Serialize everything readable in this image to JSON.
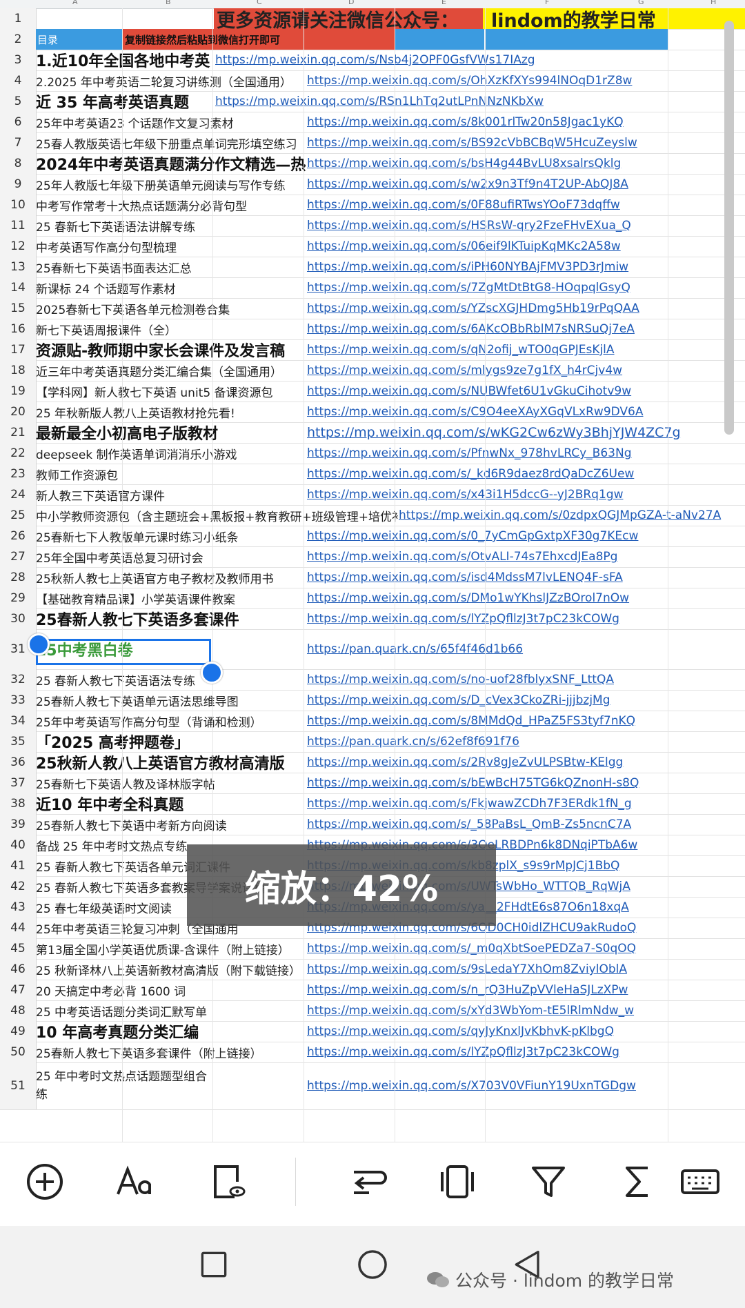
{
  "columns": [
    "A",
    "B",
    "C",
    "D",
    "E",
    "F",
    "G",
    "H"
  ],
  "banner": {
    "text1": "更多资源请关注微信公众号：",
    "text2": "lindom的教学日常"
  },
  "row2": {
    "catalog": "目录",
    "hint": "复制链接然后粘贴到微信打开即可"
  },
  "rows": [
    {
      "n": "3",
      "title": "1.近10年全国各地中考英",
      "link": "https://mp.weixin.qq.com/s/Nsb4j2OPF0GsfVWs17IAzg"
    },
    {
      "n": "4",
      "title": "2.2025 年中考英语二轮复习讲练测（全国通用）",
      "link": "https://mp.weixin.qq.com/s/OhXzKfXYs994lNOqD1rZ8w"
    },
    {
      "n": "5",
      "title": "近 35 年高考英语真题",
      "link": "https://mp.weixin.qq.com/s/RSn1LhTq2utLPnNNzNKbXw"
    },
    {
      "n": "6",
      "title": "25年中考英语23 个话题作文复习素材",
      "link": "https://mp.weixin.qq.com/s/8k001rlTw20n58Jgac1yKQ"
    },
    {
      "n": "7",
      "title": "25春人教版英语七年级下册重点单词完形填空练习",
      "link": "https://mp.weixin.qq.com/s/BS92cVbBCBqW5HcuZeyslw"
    },
    {
      "n": "8",
      "title": "2024年中考英语真题满分作文精选—热",
      "link": "https://mp.weixin.qq.com/s/bsH4g44BvLU8xsalrsQklg"
    },
    {
      "n": "9",
      "title": "25年人教版七年级下册英语单元阅读与写作专练",
      "link": "https://mp.weixin.qq.com/s/w2x9n3Tf9n4T2UP-AbQJ8A"
    },
    {
      "n": "10",
      "title": "中考写作常考十大热点话题满分必背句型",
      "link": "https://mp.weixin.qq.com/s/0F88ufiRTwsYOoF73dqffw"
    },
    {
      "n": "11",
      "title": "25 春新七下英语语法讲解专练",
      "link": "https://mp.weixin.qq.com/s/HSRsW-qry2FzeFHvEXua_Q"
    },
    {
      "n": "12",
      "title": "中考英语写作高分句型梳理",
      "link": "https://mp.weixin.qq.com/s/06eif9lKTuipKqMKc2A58w"
    },
    {
      "n": "13",
      "title": "25春新七下英语书面表达汇总",
      "link": "https://mp.weixin.qq.com/s/iPH60NYBAjFMV3PD3rJmiw"
    },
    {
      "n": "14",
      "title": "新课标 24 个话题写作素材",
      "link": "https://mp.weixin.qq.com/s/7ZgMtDtBtG8-HOqpqlGsyQ"
    },
    {
      "n": "15",
      "title": "2025春新七下英语各单元检测卷合集",
      "link": "https://mp.weixin.qq.com/s/YZscXGJHDmg5Hb19rPqQAA"
    },
    {
      "n": "16",
      "title": "新七下英语周报课件（全）",
      "link": "https://mp.weixin.qq.com/s/6AKcOBbRblM7sNRSuQj7eA"
    },
    {
      "n": "17",
      "title": "资源贴-教师期中家长会课件及发言稿",
      "link": "https://mp.weixin.qq.com/s/qN2ofij_wTO0qGPJEsKjlA"
    },
    {
      "n": "18",
      "title": "近三年中考英语真题分类汇编合集（全国通用）",
      "link": "https://mp.weixin.qq.com/s/mlygs9ze7g1fX_h4rCjv4w"
    },
    {
      "n": "19",
      "title": "【学科网】新人教七下英语 unit5 备课资源包",
      "link": "https://mp.weixin.qq.com/s/NUBWfet6U1vGkuCihotv9w"
    },
    {
      "n": "20",
      "title": "25 年秋新版人教八上英语教材抢先看!",
      "link": "https://mp.weixin.qq.com/s/C9O4eeXAyXGqVLxRw9DV6A"
    },
    {
      "n": "21",
      "title": "最新最全小初高电子版教材",
      "link": "https://mp.weixin.qq.com/s/wKG2Cw6zWy3BhjYJW4ZC7g"
    },
    {
      "n": "22",
      "title": "deepseek 制作英语单词消消乐小游戏",
      "link": "https://mp.weixin.qq.com/s/PfnwNx_978hvLRCy_B63Ng"
    },
    {
      "n": "23",
      "title": "教师工作资源包",
      "link": "https://mp.weixin.qq.com/s/_kd6R9daez8rdQaDcZ6Uew"
    },
    {
      "n": "24",
      "title": "新人教三下英语官方课件",
      "link": "https://mp.weixin.qq.com/s/x43i1H5dccG--yJ2BRq1gw"
    },
    {
      "n": "25",
      "title": "中小学教师资源包（含主题班会+黑板报+教育教研+班级管理+培优补差",
      "link": "https://mp.weixin.qq.com/s/0zdpxQGJMpGZA-t-aNv27A"
    },
    {
      "n": "26",
      "title": "25春新七下人教版单元课时练习小纸条",
      "link": "https://mp.weixin.qq.com/s/0_7yCmGpGxtpXF30g7KEcw"
    },
    {
      "n": "27",
      "title": "25年全国中考英语总复习研讨会",
      "link": "https://mp.weixin.qq.com/s/OtvALI-74s7EhxcdJEa8Pg"
    },
    {
      "n": "28",
      "title": "25秋新人教七上英语官方电子教材及教师用书",
      "link": "https://mp.weixin.qq.com/s/isd4MdssM7lvLENQ4F-sFA"
    },
    {
      "n": "29",
      "title": "【基础教育精品课】小学英语课件教案",
      "link": "https://mp.weixin.qq.com/s/DMo1wYKhslJZzBOrol7nOw"
    },
    {
      "n": "30",
      "title": "25春新人教七下英语多套课件",
      "link": "https://mp.weixin.qq.com/s/lYZpQfllzJ3t7pC23kCOWg"
    },
    {
      "n": "31",
      "title": "25中考黑白卷",
      "link": "https://pan.quark.cn/s/65f4f46d1b66"
    },
    {
      "n": "32",
      "title": "25 春新人教七下英语语法专练",
      "link": "https://mp.weixin.qq.com/s/no-uof28fblyxSNF_LttQA"
    },
    {
      "n": "33",
      "title": "25春新人教七下英语单元语法思维导图",
      "link": "https://mp.weixin.qq.com/s/D_cVex3CkoZRi-jjjbzjMg"
    },
    {
      "n": "34",
      "title": "25年中考英语写作高分句型（背诵和检测）",
      "link": "https://mp.weixin.qq.com/s/8MMdQd_HPaZ5FS3tyf7nKQ"
    },
    {
      "n": "35",
      "title": "「2025 高考押题卷」",
      "link": "https://pan.quark.cn/s/62ef8f691f76"
    },
    {
      "n": "36",
      "title": "25秋新人教八上英语官方教材高清版",
      "link": "https://mp.weixin.qq.com/s/2Rv8gJeZvULPSBtw-KElgg"
    },
    {
      "n": "37",
      "title": "25春新七下英语人教及译林版字帖",
      "link": "https://mp.weixin.qq.com/s/bEwBcH75TG6kQZnonH-s8Q"
    },
    {
      "n": "38",
      "title": "近10 年中考全科真题",
      "link": "https://mp.weixin.qq.com/s/FkjwawZCDh7F3ERdk1fN_g"
    },
    {
      "n": "39",
      "title": "25春新人教七下英语中考新方向阅读",
      "link": "https://mp.weixin.qq.com/s/_58PaBsL_QmB-Zs5ncnC7A"
    },
    {
      "n": "40",
      "title": "备战 25 年中考时文热点专练",
      "link": "https://mp.weixin.qq.com/s/3OeLRBDPn6k8DNqiPTbA6w"
    },
    {
      "n": "41",
      "title": "25 春新人教七下英语各单元词汇课件",
      "link": "https://mp.weixin.qq.com/s/kb8zplX_s9s9rMpJCj1BbQ"
    },
    {
      "n": "42",
      "title": "25 春新人教七下英语多套教案导学案说课稿",
      "link": "https://mp.weixin.qq.com/s/UWTsWbHo_WTTQB_RqWjA"
    },
    {
      "n": "43",
      "title": "25 春七年级英语时文阅读",
      "link": "https://mp.weixin.qq.com/s/ya__2FHdtE6s87O6n18xqA"
    },
    {
      "n": "44",
      "title": "25年中考英语三轮复习冲刺（全国通用",
      "link": "https://mp.weixin.qq.com/s/6OD0CH0idlZHCU9akRudoQ"
    },
    {
      "n": "45",
      "title": "第13届全国小学英语优质课-含课件（附上链接）",
      "link": "https://mp.weixin.qq.com/s/_m0qXbtSoePEDZa7-S0qOQ"
    },
    {
      "n": "46",
      "title": "25 秋新译林八上英语新教材高清版（附下载链接）",
      "link": "https://mp.weixin.qq.com/s/9sLedaY7XhOm8ZviylOblA"
    },
    {
      "n": "47",
      "title": "20 天搞定中考必背 1600 词",
      "link": "https://mp.weixin.qq.com/s/n_rQ3HuZpVVleHaSJLzXPw"
    },
    {
      "n": "48",
      "title": "25 中考英语话题分类词汇默写单",
      "link": "https://mp.weixin.qq.com/s/xYd3WbYom-tE5lRlmNdw_w"
    },
    {
      "n": "49",
      "title": "10 年高考真题分类汇编",
      "link": "https://mp.weixin.qq.com/s/qyJyKnxlJvKbhvK-pKlbgQ"
    },
    {
      "n": "50",
      "title": "25春新人教七下英语多套课件（附上链接）",
      "link": "https://mp.weixin.qq.com/s/lYZpQfllzJ3t7pC23kCOWg"
    },
    {
      "n": "51",
      "title": "25 年中考时文热点话题题型组合练",
      "link": "https://mp.weixin.qq.com/s/X703V0VFiunY19UxnTGDgw"
    }
  ],
  "zoom_text": "缩放：42%",
  "watermark": "公众号 · lindom 的教学日常",
  "toolbar_icons": [
    "plus-circle-icon",
    "text-format-icon",
    "preview-icon",
    "wrap-icon",
    "freeze-icon",
    "filter-icon",
    "sum-icon",
    "keyboard-icon"
  ],
  "nav_icons": [
    "recent-apps-icon",
    "home-icon",
    "back-icon"
  ]
}
